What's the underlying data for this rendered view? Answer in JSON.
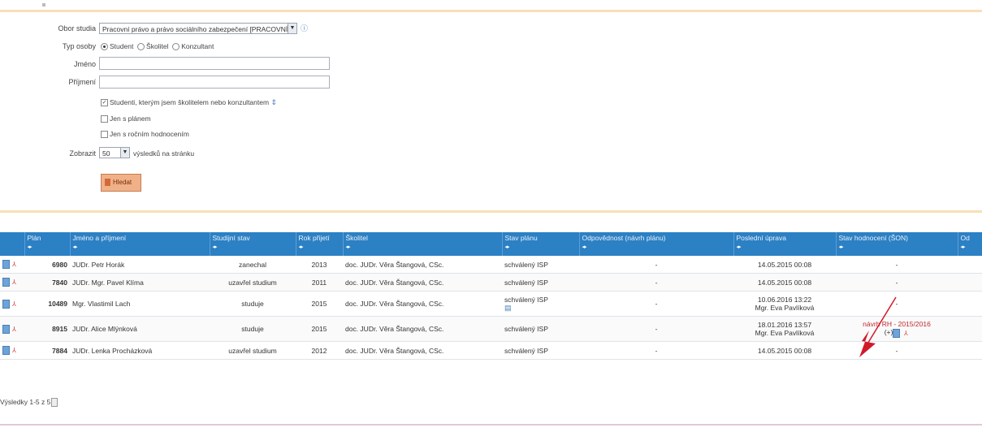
{
  "form": {
    "field_study_label": "Obor studia",
    "field_study_value": "Pracovní právo a právo sociálního zabezpečení [PRACOVNÍ]",
    "field_study_info": "ⓘ",
    "person_type_label": "Typ osoby",
    "person_type_options": [
      "Student",
      "Školitel",
      "Konzultant"
    ],
    "name_label": "Jméno",
    "surname_label": "Příjmení",
    "checkboxes": [
      {
        "label": "Studenti, kterým jsem školitelem nebo konzultantem",
        "checked": true
      },
      {
        "label": "Jen s plánem",
        "checked": false
      },
      {
        "label": "Jen s ročním hodnocením",
        "checked": false
      }
    ],
    "show_label": "Zobrazit",
    "show_value": "50",
    "show_suffix": "výsledků na stránku",
    "submit_label": "Hledat"
  },
  "table": {
    "headers": [
      "Plán",
      "Jméno a příjmení",
      "Studijní stav",
      "Rok přijetí",
      "Školitel",
      "Stav plánu",
      "Odpovědnost (návrh plánu)",
      "Poslední úprava",
      "Stav hodnocení (ŠON)",
      "Od"
    ],
    "rows": [
      {
        "id": "6980",
        "name": "JUDr. Petr Horák",
        "status": "zanechal",
        "year": "2013",
        "supervisor": "doc. JUDr. Věra Štangová, CSc.",
        "plan": "schválený ISP",
        "resp": "-",
        "modified": "14.05.2015 00:08",
        "modified_by": "",
        "eval": "-"
      },
      {
        "id": "7840",
        "name": "JUDr. Mgr. Pavel Klíma",
        "status": "uzavřel studium",
        "year": "2011",
        "supervisor": "doc. JUDr. Věra Štangová, CSc.",
        "plan": "schválený ISP",
        "resp": "-",
        "modified": "14.05.2015 00:08",
        "modified_by": "",
        "eval": "-"
      },
      {
        "id": "10489",
        "name": "Mgr. Vlastimil Lach",
        "status": "studuje",
        "year": "2015",
        "supervisor": "doc. JUDr. Věra Štangová, CSc.",
        "plan": "schválený ISP",
        "resp": "-",
        "modified": "10.06.2016 13:22",
        "modified_by": "Mgr. Eva Pavlíková",
        "eval": "-"
      },
      {
        "id": "8915",
        "name": "JUDr. Alice Mlýnková",
        "status": "studuje",
        "year": "2015",
        "supervisor": "doc. JUDr. Věra Štangová, CSc.",
        "plan": "schválený ISP",
        "resp": "-",
        "modified": "18.01.2016 13:57",
        "modified_by": "Mgr. Eva Pavlíková",
        "eval": "návrh RH - 2015/2016"
      },
      {
        "id": "7884",
        "name": "JUDr. Lenka Procházková",
        "status": "uzavřel studium",
        "year": "2012",
        "supervisor": "doc. JUDr. Věra Štangová, CSc.",
        "plan": "schválený ISP",
        "resp": "-",
        "modified": "14.05.2015 00:08",
        "modified_by": "",
        "eval": "-"
      }
    ]
  },
  "pager": "Výsledky 1-5 z 5",
  "colors": {
    "header": "#2c80c4",
    "accent": "#f0b189",
    "annotation": "#d11a2a"
  }
}
